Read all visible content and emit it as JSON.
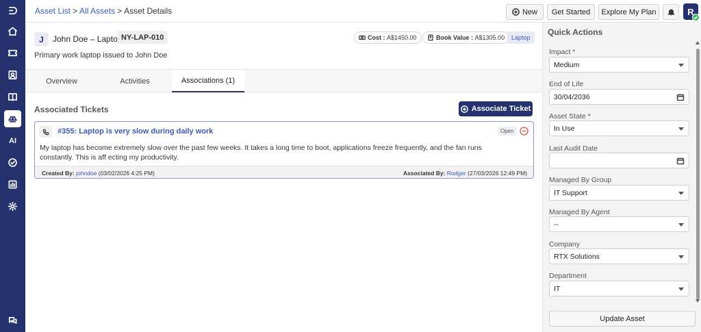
{
  "breadcrumb": {
    "items": [
      "Asset List",
      "All Assets",
      "Asset Details"
    ],
    "separator": ">"
  },
  "header": {
    "new_label": "New",
    "get_started_label": "Get Started",
    "explore_label": "Explore My Plan",
    "avatar_initial": "R"
  },
  "asset": {
    "initial": "J",
    "name": "John Doe – Laptop",
    "code": "NY-LAP-010",
    "description": "Primary work laptop issued to John Doe",
    "cost_label": "Cost :",
    "cost_value": "A$1450.00",
    "book_value_label": "Book Value :",
    "book_value_value": "A$1305.00",
    "type": "Laptop"
  },
  "tabs": [
    {
      "label": "Overview"
    },
    {
      "label": "Activities"
    },
    {
      "label": "Associations (1)"
    }
  ],
  "associations": {
    "section_title": "Associated Tickets",
    "associate_button": "Associate Ticket",
    "tickets": [
      {
        "title": "#355: Laptop is very slow during daily work",
        "status": "Open",
        "body": "My laptop has become extremely slow over the past few weeks. It takes a long time to boot, applications freeze frequently, and the fan runs constantly. This is aff ecting my productivity.",
        "created_by_label": "Created By:",
        "created_by_user": "johndoe",
        "created_at": "(03/02/2026 4:25 PM)",
        "associated_by_label": "Associated By:",
        "associated_by_user": "Rodger",
        "associated_at": "(27/03/2026 12:49 PM)"
      }
    ]
  },
  "quick_actions": {
    "title": "Quick Actions",
    "fields": [
      {
        "label": "Impact *",
        "value": "Medium",
        "kind": "select"
      },
      {
        "label": "End of Life",
        "value": "30/04/2036",
        "kind": "date"
      },
      {
        "label": "Asset State *",
        "value": "In Use",
        "kind": "select"
      },
      {
        "label": "Last Audit Date",
        "value": "",
        "kind": "date"
      },
      {
        "label": "Managed By Group",
        "value": "IT Support",
        "kind": "select"
      },
      {
        "label": "Managed By Agent",
        "value": "--",
        "kind": "select"
      },
      {
        "label": "Company",
        "value": "RTX Solutions",
        "kind": "select"
      },
      {
        "label": "Department",
        "value": "IT",
        "kind": "select"
      }
    ],
    "update_button": "Update Asset"
  },
  "sidebar": {
    "items": [
      {
        "icon": "logo-icon"
      },
      {
        "icon": "home-icon"
      },
      {
        "icon": "ticket-icon"
      },
      {
        "icon": "contact-icon"
      },
      {
        "icon": "knowledge-base-icon"
      },
      {
        "icon": "assets-icon",
        "active": true
      },
      {
        "icon": "ai-icon",
        "text": "AI"
      },
      {
        "icon": "tasks-icon"
      },
      {
        "icon": "reports-icon"
      },
      {
        "icon": "settings-icon"
      },
      {
        "icon": "chat-icon"
      }
    ]
  },
  "colors": {
    "brand": "#26326e",
    "link": "#3c59b5",
    "danger": "#d9534f",
    "online": "#3cb55a"
  }
}
